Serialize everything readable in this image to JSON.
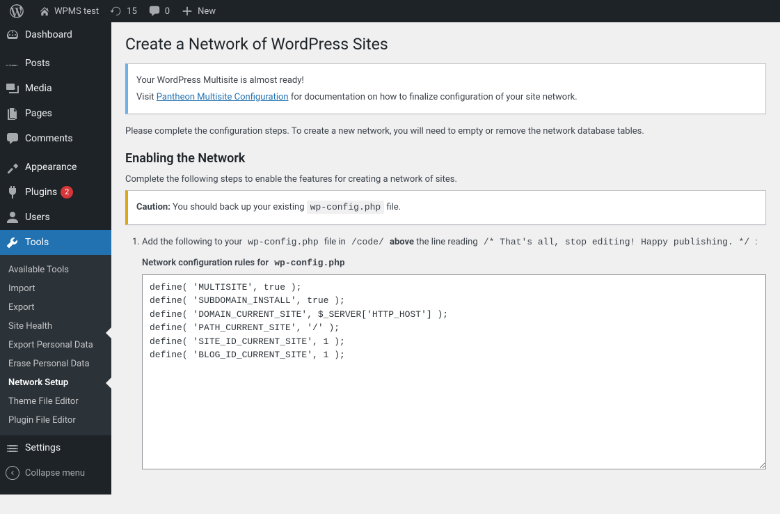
{
  "adminbar": {
    "site_name": "WPMS test",
    "updates_count": "15",
    "comments_count": "0",
    "new_label": "New"
  },
  "sidebar": {
    "dashboard": "Dashboard",
    "posts": "Posts",
    "media": "Media",
    "pages": "Pages",
    "comments": "Comments",
    "appearance": "Appearance",
    "plugins": "Plugins",
    "plugins_count": "2",
    "users": "Users",
    "tools": "Tools",
    "settings": "Settings",
    "collapse": "Collapse menu",
    "tools_submenu": [
      "Available Tools",
      "Import",
      "Export",
      "Site Health",
      "Export Personal Data",
      "Erase Personal Data",
      "Network Setup",
      "Theme File Editor",
      "Plugin File Editor"
    ]
  },
  "page": {
    "title": "Create a Network of WordPress Sites",
    "notice_ready": "Your WordPress Multisite is almost ready!",
    "notice_visit_pre": "Visit ",
    "notice_visit_link": "Pantheon Multisite Configuration",
    "notice_visit_post": " for documentation on how to finalize configuration of your site network.",
    "please_complete": "Please complete the configuration steps. To create a new network, you will need to empty or remove the network database tables.",
    "enabling_heading": "Enabling the Network",
    "complete_steps": "Complete the following steps to enable the features for creating a network of sites.",
    "caution_label": "Caution:",
    "caution_text": " You should back up your existing ",
    "caution_file": "wp-config.php",
    "caution_after": " file.",
    "step1_pre": "Add the following to your ",
    "step1_code1": "wp-config.php",
    "step1_mid1": " file in ",
    "step1_code2": "/code/",
    "step1_above": "above",
    "step1_mid2": " the line reading ",
    "step1_code3": "/* That's all, stop editing! Happy publishing. */",
    "step1_end": " :",
    "rules_label_pre": "Network configuration rules for ",
    "rules_label_code": "wp-config.php",
    "network_config": "define( 'MULTISITE', true );\ndefine( 'SUBDOMAIN_INSTALL', true );\ndefine( 'DOMAIN_CURRENT_SITE', $_SERVER['HTTP_HOST'] );\ndefine( 'PATH_CURRENT_SITE', '/' );\ndefine( 'SITE_ID_CURRENT_SITE', 1 );\ndefine( 'BLOG_ID_CURRENT_SITE', 1 );"
  }
}
